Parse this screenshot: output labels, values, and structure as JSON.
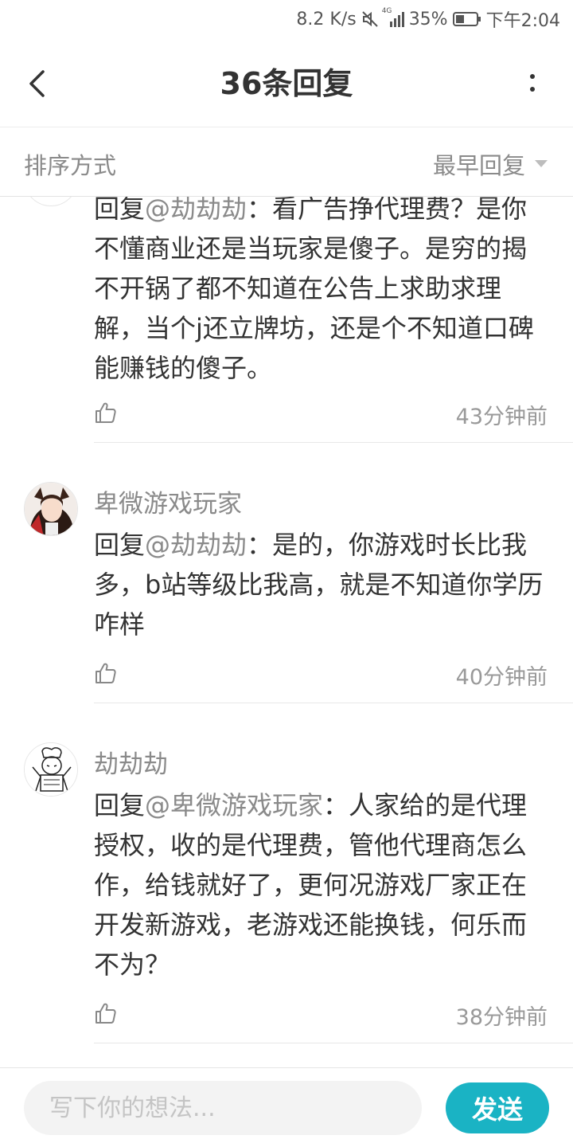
{
  "status_bar": {
    "speed": "8.2 K/s",
    "network": "4G",
    "battery": "35%",
    "time": "下午2:04"
  },
  "header": {
    "title": "36条回复"
  },
  "sort": {
    "label": "排序方式",
    "selected": "最早回复"
  },
  "comments": [
    {
      "username": "",
      "reply_prefix": "回复",
      "mention": "@劫劫劫",
      "text": "：看广告挣代理费？是你不懂商业还是当玩家是傻子。是穷的揭不开锅了都不知道在公告上求助求理解，当个j还立牌坊，还是个不知道口碑能赚钱的傻子。",
      "time": "43分钟前"
    },
    {
      "username": "卑微游戏玩家",
      "reply_prefix": "回复",
      "mention": "@劫劫劫",
      "text": "：是的，你游戏时长比我多，b站等级比我高，就是不知道你学历咋样",
      "time": "40分钟前"
    },
    {
      "username": "劫劫劫",
      "reply_prefix": "回复",
      "mention": "@卑微游戏玩家",
      "text": "：人家给的是代理授权，收的是代理费，管他代理商怎么作，给钱就好了，更何况游戏厂家正在开发新游戏，老游戏还能换钱，何乐而不为？",
      "time": "38分钟前"
    }
  ],
  "composer": {
    "placeholder": "写下你的想法...",
    "send_label": "发送"
  },
  "colors": {
    "accent": "#1ab3c4",
    "muted_text": "#8a8a8a"
  },
  "icons": {
    "back": "chevron-left-icon",
    "more": "more-vertical-icon",
    "dropdown": "caret-down-icon",
    "like": "thumbs-up-icon"
  }
}
